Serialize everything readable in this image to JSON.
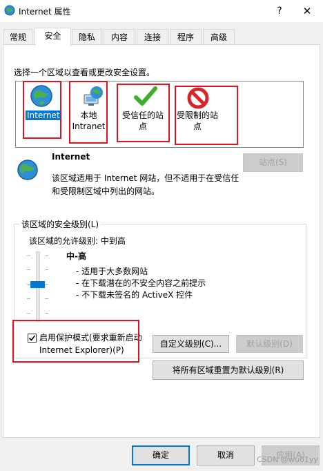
{
  "window": {
    "title": "Internet 属性",
    "help": "?",
    "close": "✕"
  },
  "tabs": [
    {
      "label": "常规"
    },
    {
      "label": "安全"
    },
    {
      "label": "隐私"
    },
    {
      "label": "内容"
    },
    {
      "label": "连接"
    },
    {
      "label": "程序"
    },
    {
      "label": "高级"
    }
  ],
  "active_tab": "安全",
  "security": {
    "zone_prompt": "选择一个区域以查看或更改安全设置。",
    "zones": [
      {
        "label": "Internet",
        "icon": "globe-icon",
        "selected": true
      },
      {
        "label_line1": "本地",
        "label_line2": "Intranet",
        "icon": "intranet-icon"
      },
      {
        "label_line1": "受信任的站",
        "label_line2": "点",
        "icon": "checkmark-icon"
      },
      {
        "label_line1": "受限制的站",
        "label_line2": "点",
        "icon": "restricted-icon"
      }
    ],
    "selected_zone": {
      "title": "Internet",
      "description": "该区域适用于 Internet 网站，但不适用于在受信任和受限制区域中列出的网站。",
      "sites_button": "站点(S)"
    },
    "level": {
      "group_title": "该区域的安全级别(L)",
      "allowed": "该区域的允许级别: 中到高",
      "name": "中-高",
      "details": [
        "- 适用于大多数网站",
        "- 在下载潜在的不安全内容之前提示",
        "- 不下载未签名的 ActiveX 控件"
      ]
    },
    "protected_mode": {
      "label": "启用保护模式(要求重新启动 Internet Explorer)(P)",
      "checked": true
    },
    "custom_level_button": "自定义级别(C)...",
    "default_level_button": "默认级别(D)",
    "reset_all_button": "将所有区域重置为默认级别(R)"
  },
  "footer": {
    "ok": "确定",
    "cancel": "取消",
    "apply": "应用(A)"
  },
  "watermark": "CSDN @wu61yy",
  "colors": {
    "accent": "#0078d7",
    "highlight_box": "#e0141e"
  }
}
